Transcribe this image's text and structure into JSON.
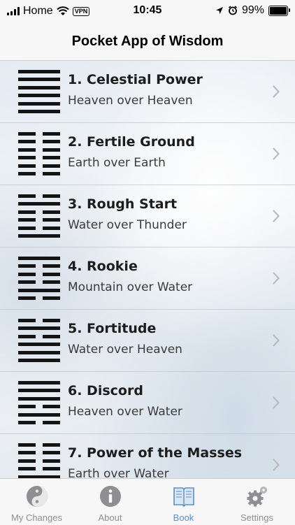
{
  "status_bar": {
    "carrier": "Home",
    "vpn": "VPN",
    "time": "10:45",
    "battery": "99%",
    "battery_level": 0.99
  },
  "nav": {
    "title": "Pocket App of Wisdom"
  },
  "hexagrams": [
    {
      "title": "1. Celestial Power",
      "subtitle": "Heaven over Heaven",
      "lines": [
        1,
        1,
        1,
        1,
        1,
        1
      ]
    },
    {
      "title": "2. Fertile Ground",
      "subtitle": "Earth over Earth",
      "lines": [
        0,
        0,
        0,
        0,
        0,
        0
      ]
    },
    {
      "title": "3. Rough Start",
      "subtitle": "Water over Thunder",
      "lines": [
        0,
        1,
        0,
        0,
        0,
        1
      ]
    },
    {
      "title": "4. Rookie",
      "subtitle": "Mountain over Water",
      "lines": [
        1,
        0,
        0,
        0,
        1,
        0
      ]
    },
    {
      "title": "5. Fortitude",
      "subtitle": "Water over Heaven",
      "lines": [
        0,
        1,
        0,
        1,
        1,
        1
      ]
    },
    {
      "title": "6. Discord",
      "subtitle": "Heaven over Water",
      "lines": [
        1,
        1,
        1,
        0,
        1,
        0
      ]
    },
    {
      "title": "7. Power of the Masses",
      "subtitle": "Earth over Water",
      "lines": [
        0,
        0,
        0,
        0,
        1,
        0
      ]
    }
  ],
  "tabs": [
    {
      "label": "My Changes",
      "icon": "yin-yang-icon",
      "active": false
    },
    {
      "label": "About",
      "icon": "info-icon",
      "active": false
    },
    {
      "label": "Book",
      "icon": "book-icon",
      "active": true
    },
    {
      "label": "Settings",
      "icon": "gears-icon",
      "active": false
    }
  ],
  "colors": {
    "accent": "#5b8fc7",
    "inactive": "#8e8e93",
    "ink": "#141414"
  }
}
